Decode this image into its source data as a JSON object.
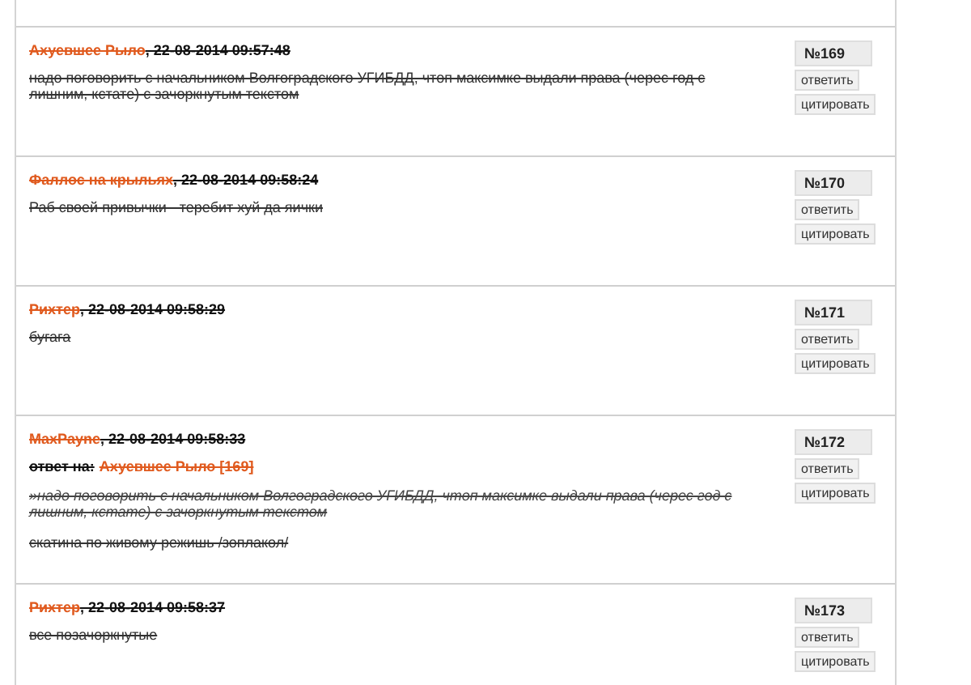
{
  "struck_out": true,
  "posts": [
    {
      "author": "Ахуевшее Рыло",
      "date": ", 22-08-2014 09:57:48",
      "body": [
        "надо поговорить с начальником Волгоградского УГИБДД, чтоп максимке выдали права (черес год с лишним, кстате) с зачоркнутым текстом"
      ],
      "number": "№169",
      "buttons": [
        "ответить",
        "цитировать"
      ]
    },
    {
      "author": "Фаллос на крыльях",
      "date": ", 22-08-2014 09:58:24",
      "body": [
        "Раб своей привычки - теребит хуй да яички"
      ],
      "number": "№170",
      "buttons": [
        "ответить",
        "цитировать"
      ]
    },
    {
      "author": "Рихтер",
      "date": ", 22-08-2014 09:58:29",
      "body": [
        "бугага"
      ],
      "number": "№171",
      "buttons": [
        "ответить",
        "цитировать"
      ]
    },
    {
      "author": "MaxPayne",
      "date": ", 22-08-2014 09:58:33",
      "reply_to": {
        "label": "ответ на:",
        "link": "Ахуевшее Рыло [169]"
      },
      "quote": "»надо поговорить с начальником Волгоградского УГИБДД, чтоп максимке выдали права (черес год с лишним, кстате) с зачоркнутым текстом",
      "body": [
        "скатина по живому режишь /зоплакол/"
      ],
      "number": "№172",
      "buttons": [
        "ответить",
        "цитировать"
      ]
    },
    {
      "author": "Рихтер",
      "date": ", 22-08-2014 09:58:37",
      "body": [
        "все позачоркнутые"
      ],
      "number": "№173",
      "buttons": [
        "ответить",
        "цитировать"
      ]
    }
  ]
}
